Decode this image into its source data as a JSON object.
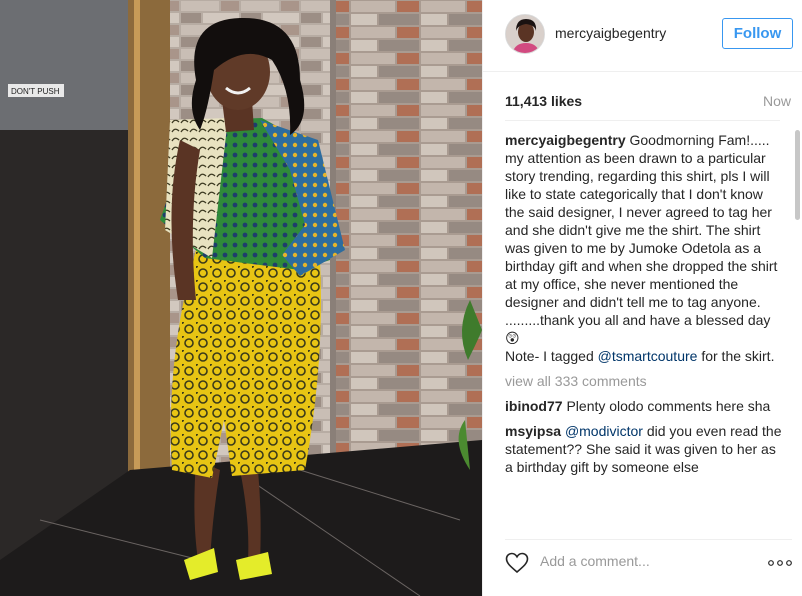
{
  "post": {
    "username": "mercyaigbegentry",
    "follow_label": "Follow",
    "likes": "11,413 likes",
    "time": "Now"
  },
  "photo": {
    "sign_text": "DON'T PUSH",
    "colors": {
      "wall": "#a89f97",
      "floor": "#1c1a1a",
      "shirt_green": "#2f7d3a",
      "shirt_blue": "#2e5f8e",
      "skirt_yellow": "#e9c613"
    }
  },
  "caption": {
    "author": "mercyaigbegentry",
    "text_1": "Goodmorning Fam!..... my attention as been drawn to a particular story trending, regarding this shirt, pls I will like to state categorically that I don't know the said designer, I never agreed to tag her and she didn't give me the shirt. The shirt was given to me by Jumoke Odetola as a birthday gift and when she dropped the shirt at my office, she never mentioned the designer and didn't tell me to tag anyone. .........thank you all and have a blessed day",
    "emoji": "😲",
    "text_2": "Note- I tagged",
    "mention": "@tsmartcouture",
    "text_3": "for the skirt."
  },
  "view_all": "view all 333 comments",
  "comments": [
    {
      "author": "ibinod77",
      "text": "Plenty olodo comments here sha"
    },
    {
      "author": "msyipsa",
      "mention": "@modivictor",
      "text": "did you even read the statement?? She said it was given to her as a birthday gift by someone else"
    }
  ],
  "footer": {
    "placeholder": "Add a comment...",
    "heart_icon": "heart-icon",
    "more_icon": "more-options-icon"
  },
  "colors": {
    "accent": "#3897f0",
    "mention": "#003569",
    "muted": "#999999"
  }
}
